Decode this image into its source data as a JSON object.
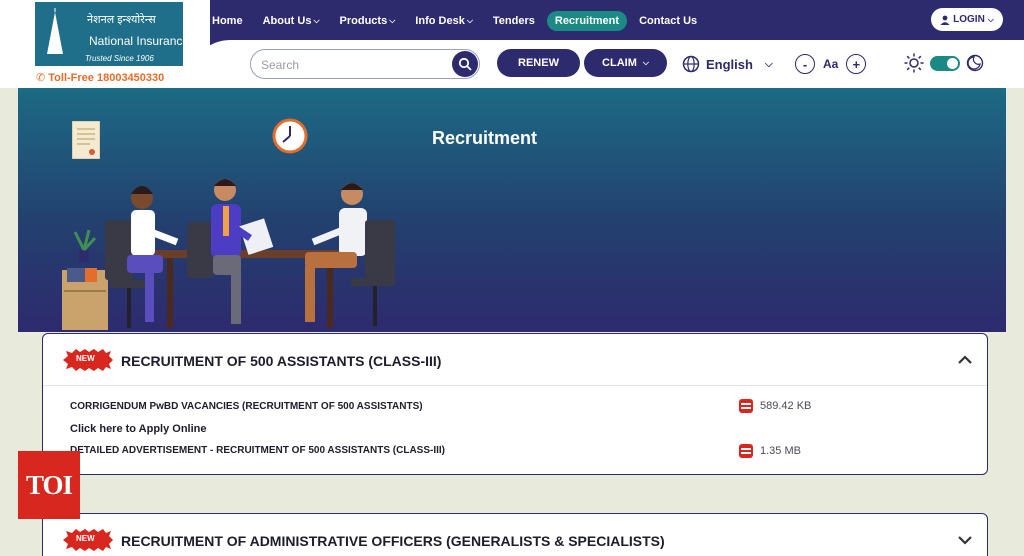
{
  "brand": {
    "name_hindi": "नेशनल इन्श्योरेन्स",
    "name": "National Insurance",
    "tagline": "Trusted Since 1906",
    "tollfree": "Toll-Free 18003450330"
  },
  "nav": {
    "items": [
      {
        "label": "Home",
        "caret": false,
        "active": false
      },
      {
        "label": "About Us",
        "caret": true,
        "active": false
      },
      {
        "label": "Products",
        "caret": true,
        "active": false
      },
      {
        "label": "Info Desk",
        "caret": true,
        "active": false
      },
      {
        "label": "Tenders",
        "caret": false,
        "active": false
      },
      {
        "label": "Recruitment",
        "caret": false,
        "active": true
      },
      {
        "label": "Contact Us",
        "caret": false,
        "active": false
      }
    ],
    "login": "LOGIN"
  },
  "toolbar": {
    "search_placeholder": "Search",
    "renew": "RENEW",
    "claim": "CLAIM",
    "language": "English",
    "font_minus": "-",
    "font_label": "Aa",
    "font_plus": "+"
  },
  "banner": {
    "title": "Recruitment"
  },
  "sections": [
    {
      "badge": "NEW",
      "title": "RECRUITMENT OF 500 ASSISTANTS (CLASS-III)",
      "expanded": true,
      "docs": [
        {
          "label": "CORRIGENDUM PwBD VACANCIES (RECRUITMENT OF 500 ASSISTANTS)",
          "size": "589.42 KB"
        },
        {
          "label": "Click here to Apply Online",
          "size": ""
        },
        {
          "label": "DETAILED ADVERTISEMENT - RECRUITMENT OF 500 ASSISTANTS (CLASS-III)",
          "size": "1.35 MB"
        }
      ]
    },
    {
      "badge": "NEW",
      "title": "RECRUITMENT OF ADMINISTRATIVE OFFICERS (GENERALISTS & SPECIALISTS)",
      "expanded": false,
      "docs": []
    }
  ],
  "watermark": "TOI",
  "colors": {
    "primary": "#2e2a6e",
    "accent": "#1c8a84",
    "badge": "#d7271f"
  }
}
